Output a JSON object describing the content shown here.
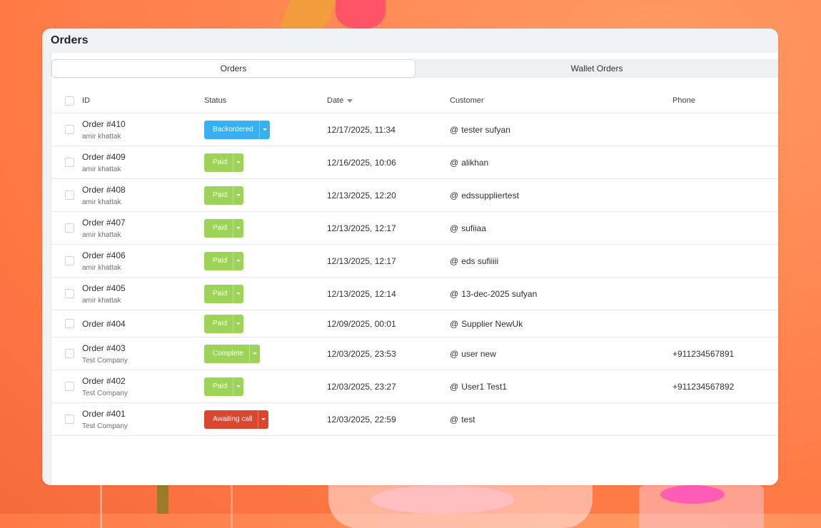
{
  "page": {
    "title": "Orders"
  },
  "tabs": [
    {
      "label": "Orders",
      "active": true
    },
    {
      "label": "Wallet Orders",
      "active": false
    }
  ],
  "table": {
    "headers": {
      "id": "ID",
      "status": "Status",
      "date": "Date",
      "customer": "Customer",
      "phone": "Phone"
    },
    "rows": [
      {
        "id": "Order #410",
        "sub": "amir khattak",
        "status": "Backordered",
        "status_color": "#3ab0f0",
        "date": "12/17/2025, 11:34",
        "customer": "tester sufyan",
        "phone": ""
      },
      {
        "id": "Order #409",
        "sub": "amir khattak",
        "status": "Paid",
        "status_color": "#9ed35a",
        "date": "12/16/2025, 10:06",
        "customer": "alikhan",
        "phone": ""
      },
      {
        "id": "Order #408",
        "sub": "amir khattak",
        "status": "Paid",
        "status_color": "#9ed35a",
        "date": "12/13/2025, 12:20",
        "customer": "edssuppliertest",
        "phone": ""
      },
      {
        "id": "Order #407",
        "sub": "amir khattak",
        "status": "Paid",
        "status_color": "#9ed35a",
        "date": "12/13/2025, 12:17",
        "customer": "sufiiaa",
        "phone": ""
      },
      {
        "id": "Order #406",
        "sub": "amir khattak",
        "status": "Paid",
        "status_color": "#9ed35a",
        "date": "12/13/2025, 12:17",
        "customer": "eds sufiiiii",
        "phone": ""
      },
      {
        "id": "Order #405",
        "sub": "amir khattak",
        "status": "Paid",
        "status_color": "#9ed35a",
        "date": "12/13/2025, 12:14",
        "customer": "13-dec-2025 sufyan",
        "phone": ""
      },
      {
        "id": "Order #404",
        "sub": "",
        "status": "Paid",
        "status_color": "#9ed35a",
        "date": "12/09/2025, 00:01",
        "customer": "Supplier NewUk",
        "phone": ""
      },
      {
        "id": "Order #403",
        "sub": "Test Company",
        "status": "Complete",
        "status_color": "#9ed35a",
        "date": "12/03/2025, 23:53",
        "customer": "user new",
        "phone": "+911234567891"
      },
      {
        "id": "Order #402",
        "sub": "Test Company",
        "status": "Paid",
        "status_color": "#9ed35a",
        "date": "12/03/2025, 23:27",
        "customer": "User1 Test1",
        "phone": "+911234567892"
      },
      {
        "id": "Order #401",
        "sub": "Test Company",
        "status": "Awaiting call",
        "status_color": "#d9472f",
        "date": "12/03/2025, 22:59",
        "customer": "test",
        "phone": ""
      }
    ]
  },
  "customer_prefix": "@"
}
